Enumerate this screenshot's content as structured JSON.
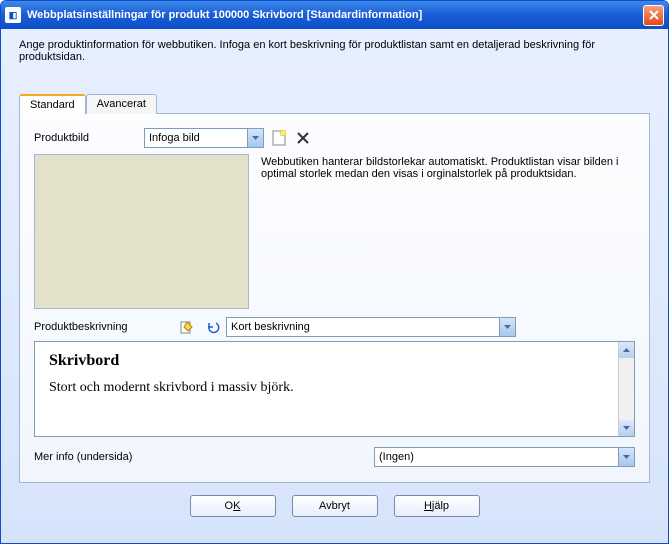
{
  "window": {
    "title": "Webbplatsinställningar för produkt 100000 Skrivbord [Standardinformation]"
  },
  "intro": "Ange produktinformation för webbutiken. Infoga en kort beskrivning för produktlistan samt en detaljerad beskrivning för produktsidan.",
  "tabs": {
    "standard": "Standard",
    "avancerat": "Avancerat"
  },
  "labels": {
    "produktbild": "Produktbild",
    "produktbeskrivning": "Produktbeskrivning",
    "merinfo": "Mer info (undersida)"
  },
  "combos": {
    "infoga_bild": "Infoga bild",
    "kort_beskrivning": "Kort beskrivning",
    "ingen": "(Ingen)"
  },
  "hint": "Webbutiken hanterar bildstorlekar automatiskt. Produktlistan visar bilden i optimal storlek medan den visas i orginalstorlek på produktsidan.",
  "editor": {
    "heading": "Skrivbord",
    "body": "Stort och modernt skrivbord i massiv björk."
  },
  "buttons": {
    "ok_pre": "O",
    "ok_ul": "K",
    "avbryt": "Avbryt",
    "hjalp_ul": "H",
    "hjalp_rest": "jälp"
  }
}
